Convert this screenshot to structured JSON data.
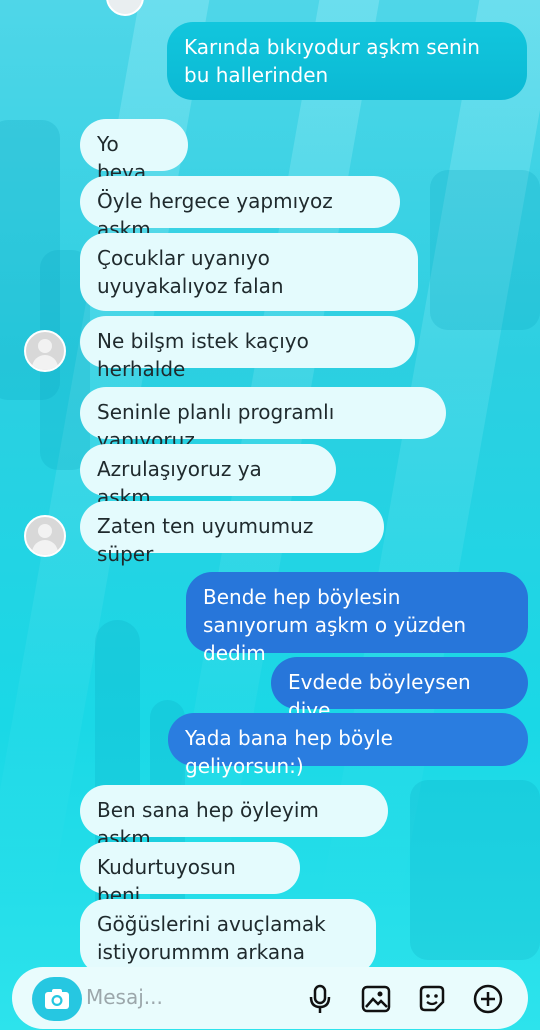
{
  "messages": [
    {
      "side": "out",
      "text": "Karında bıkıyodur aşkm senin bu hallerinden"
    },
    {
      "side": "in",
      "text": "Yo beya"
    },
    {
      "side": "in",
      "text": "Öyle hergece yapmıyoz aşkm"
    },
    {
      "side": "in",
      "text": "Çocuklar uyanıyo uyuyakalıyoz falan"
    },
    {
      "side": "in",
      "text": "Ne bilşm istek kaçıyo herhalde"
    },
    {
      "side": "in",
      "text": "Seninle planlı programlı yapıyoruz"
    },
    {
      "side": "in",
      "text": "Azrulaşıyoruz ya aşkm"
    },
    {
      "side": "in",
      "text": "Zaten ten uyumumuz süper"
    },
    {
      "side": "out",
      "text": "Bende hep böylesin sanıyorum aşkm o yüzden dedim"
    },
    {
      "side": "out",
      "text": "Evdede böyleysen diye"
    },
    {
      "side": "out",
      "text": "Yada bana hep böyle geliyorsun:)"
    },
    {
      "side": "in",
      "text": "Ben sana hep öyleyim aşkm"
    },
    {
      "side": "in",
      "text": "Kudurtuyosun beni"
    },
    {
      "side": "in",
      "text": "Göğüslerini avuçlamak istiyorummm arkana geçip"
    }
  ],
  "composer": {
    "placeholder": "Mesaj...",
    "icons": [
      "camera-icon",
      "microphone-icon",
      "image-icon",
      "sticker-icon",
      "add-icon"
    ]
  },
  "colors": {
    "incoming_bubble": "#e4fbfd",
    "outgoing_bubble_cyan": "#10c1da",
    "outgoing_bubble_blue": "#2776da",
    "background": "#2ccfe1"
  }
}
